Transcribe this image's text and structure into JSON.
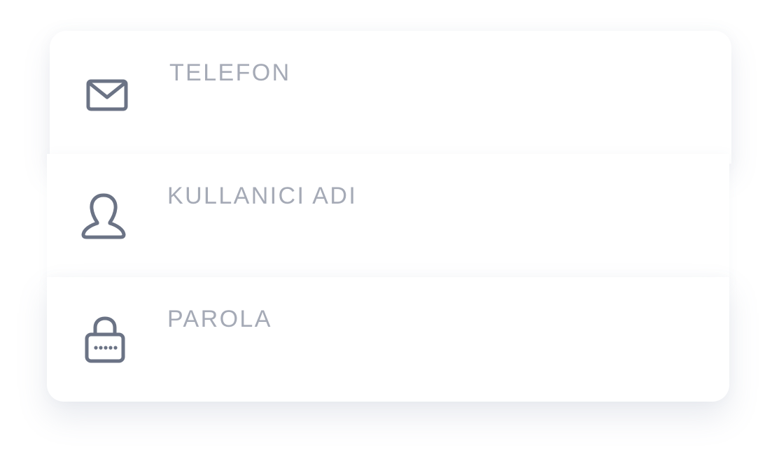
{
  "form": {
    "fields": [
      {
        "id": "telefon",
        "label": "TELEFON",
        "value": "",
        "icon": "mail-icon"
      },
      {
        "id": "username",
        "label": "KULLANICI ADI",
        "value": "",
        "icon": "user-icon"
      },
      {
        "id": "password",
        "label": "PAROLA",
        "value": "",
        "icon": "lock-icon"
      }
    ]
  },
  "colors": {
    "icon": "#6b7385",
    "label": "#a5aab6",
    "card": "#ffffff"
  }
}
